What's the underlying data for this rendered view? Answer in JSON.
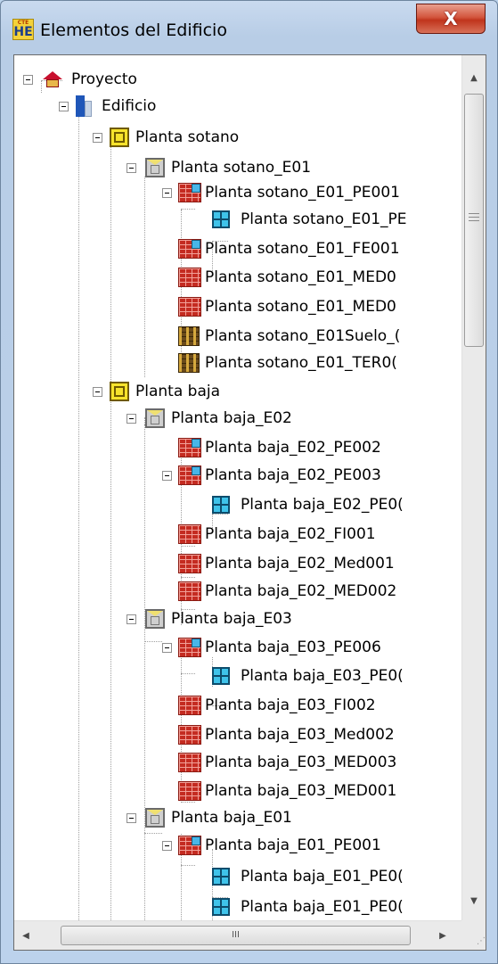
{
  "window": {
    "title": "Elementos del Edificio",
    "app_icon": {
      "top": "CTE",
      "bottom": "HE"
    },
    "close_label": "X"
  },
  "tree": {
    "items": [
      {
        "label": "Proyecto",
        "icon": "house-icon"
      },
      {
        "label": "Edificio",
        "icon": "building-icon"
      },
      {
        "label": "Planta sotano",
        "icon": "floor-icon"
      },
      {
        "label": "Planta sotano_E01",
        "icon": "space-icon"
      },
      {
        "label": "Planta sotano_E01_PE001",
        "icon": "wall-with-window-icon"
      },
      {
        "label": "Planta sotano_E01_PE",
        "icon": "window-icon"
      },
      {
        "label": "Planta sotano_E01_FE001",
        "icon": "wall-with-window-icon"
      },
      {
        "label": "Planta sotano_E01_MED0",
        "icon": "brick-wall-icon"
      },
      {
        "label": "Planta sotano_E01_MED0",
        "icon": "brick-wall-icon"
      },
      {
        "label": "Planta sotano_E01Suelo_(",
        "icon": "ground-icon"
      },
      {
        "label": "Planta sotano_E01_TER0(",
        "icon": "ground-icon"
      },
      {
        "label": "Planta baja",
        "icon": "floor-icon"
      },
      {
        "label": "Planta baja_E02",
        "icon": "space-icon"
      },
      {
        "label": "Planta baja_E02_PE002",
        "icon": "wall-with-window-icon"
      },
      {
        "label": "Planta baja_E02_PE003",
        "icon": "wall-with-window-icon"
      },
      {
        "label": "Planta baja_E02_PE0(",
        "icon": "window-icon"
      },
      {
        "label": "Planta baja_E02_FI001",
        "icon": "brick-wall-icon"
      },
      {
        "label": "Planta baja_E02_Med001",
        "icon": "brick-wall-icon"
      },
      {
        "label": "Planta baja_E02_MED002",
        "icon": "brick-wall-icon"
      },
      {
        "label": "Planta baja_E03",
        "icon": "space-icon"
      },
      {
        "label": "Planta baja_E03_PE006",
        "icon": "wall-with-window-icon"
      },
      {
        "label": "Planta baja_E03_PE0(",
        "icon": "window-icon"
      },
      {
        "label": "Planta baja_E03_FI002",
        "icon": "brick-wall-icon"
      },
      {
        "label": "Planta baja_E03_Med002",
        "icon": "brick-wall-icon"
      },
      {
        "label": "Planta baja_E03_MED003",
        "icon": "brick-wall-icon"
      },
      {
        "label": "Planta baja_E03_MED001",
        "icon": "brick-wall-icon"
      },
      {
        "label": "Planta baja_E01",
        "icon": "space-icon"
      },
      {
        "label": "Planta baja_E01_PE001",
        "icon": "wall-with-window-icon"
      },
      {
        "label": "Planta baja_E01_PE0(",
        "icon": "window-icon"
      },
      {
        "label": "Planta baja_E01_PE0(",
        "icon": "window-icon"
      }
    ]
  },
  "scrollbar": {
    "up_arrow": "▲",
    "down_arrow": "▼",
    "left_arrow": "◀",
    "right_arrow": "▶",
    "hthumb_grip": "III",
    "vthumb_grip": "≡"
  }
}
